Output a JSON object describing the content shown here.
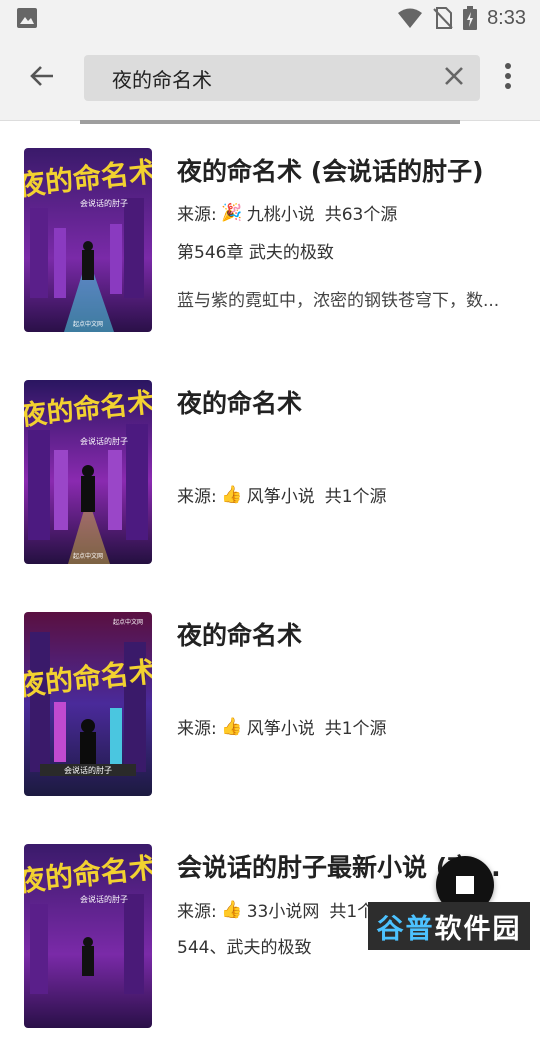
{
  "status_bar": {
    "time": "8:33",
    "icons": [
      "image-icon",
      "wifi-icon",
      "no-sim-icon",
      "battery-charging-icon"
    ]
  },
  "toolbar": {
    "search_value": "夜的命名术",
    "icons": [
      "back-arrow-icon",
      "clear-icon",
      "more-vert-icon"
    ]
  },
  "results": [
    {
      "title": "夜的命名术 (会说话的肘子)",
      "source_label": "来源:",
      "source_emoji": "🎉",
      "source_name": "九桃小说",
      "source_count": "共63个源",
      "latest_chapter": "第546章 武夫的极致",
      "intro": "蓝与紫的霓虹中，浓密的钢铁苍穹下，数..."
    },
    {
      "title": "夜的命名术",
      "source_label": "来源:",
      "source_emoji": "👍",
      "source_name": "风筝小说",
      "source_count": "共1个源",
      "latest_chapter": "",
      "intro": ""
    },
    {
      "title": "夜的命名术",
      "source_label": "来源:",
      "source_emoji": "👍",
      "source_name": "风筝小说",
      "source_count": "共1个源",
      "latest_chapter": "",
      "intro": ""
    },
    {
      "title": "会说话的肘子最新小说 (夜...",
      "source_label": "来源:",
      "source_emoji": "👍",
      "source_name": "33小说网",
      "source_count": "共1个源",
      "latest_chapter": "544、武夫的极致",
      "intro": ""
    }
  ],
  "cover_text": {
    "title": "夜的命名术",
    "author": "会说话的肘子",
    "publisher": "起点中文网"
  },
  "fab": {
    "icon": "stop-icon"
  },
  "watermark": {
    "part1": "谷普",
    "part2": "软件园"
  },
  "colors": {
    "toolbar_bg": "#f2f2f2",
    "searchbox_bg": "#dcdcdc",
    "cover_purple": "#6a2a9a",
    "cover_title_yellow": "#f2d230",
    "fab_bg": "#111111"
  }
}
